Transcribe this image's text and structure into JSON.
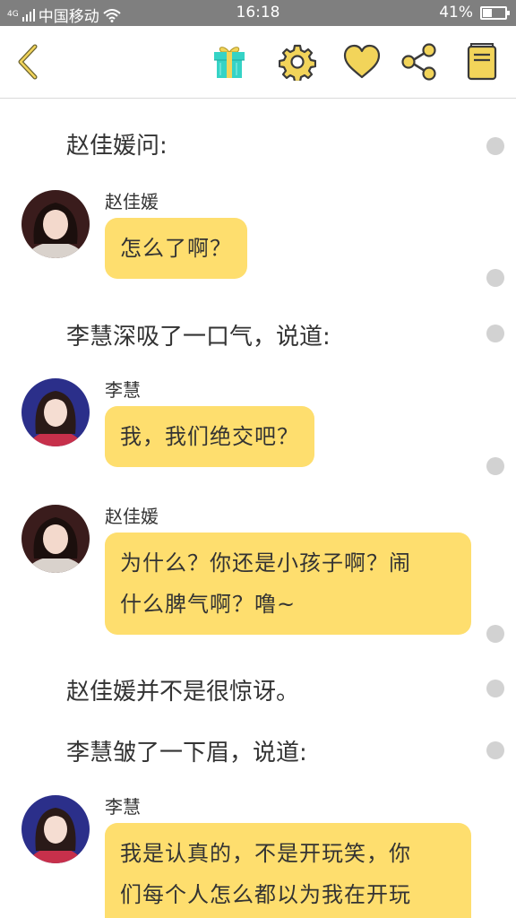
{
  "status_bar": {
    "network_label": "4G",
    "carrier": "中国移动",
    "time": "16:18",
    "battery_text": "41%",
    "battery_level": 0.41,
    "icons": [
      "signal-icon",
      "wifi-icon",
      "battery-icon"
    ]
  },
  "toolbar": {
    "icons": [
      "back-arrow-icon",
      "gift-icon",
      "gear-icon",
      "heart-icon",
      "share-icon",
      "book-icon"
    ],
    "accent_color": "#f2d45a",
    "gift_color": "#35d3c6"
  },
  "colors": {
    "bubble": "#fede6e",
    "dot": "#d2d2d2",
    "status_bar": "#7f7f7f"
  },
  "chat": {
    "narration_1": "赵佳媛问:",
    "msg_1": {
      "name": "赵佳媛",
      "text": "怎么了啊？"
    },
    "narration_2": "李慧深吸了一口气，说道:",
    "msg_2": {
      "name": "李慧",
      "text": "我，我们绝交吧？"
    },
    "msg_3": {
      "name": "赵佳媛",
      "line1": "为什么？你还是小孩子啊？闹",
      "line2": "什么脾气啊？噜~"
    },
    "narration_3": "赵佳媛并不是很惊讶。",
    "narration_4": "李慧皱了一下眉，说道:",
    "msg_4": {
      "name": "李慧",
      "line1": "我是认真的，不是开玩笑，你",
      "line2": "们每个人怎么都以为我在开玩"
    }
  }
}
